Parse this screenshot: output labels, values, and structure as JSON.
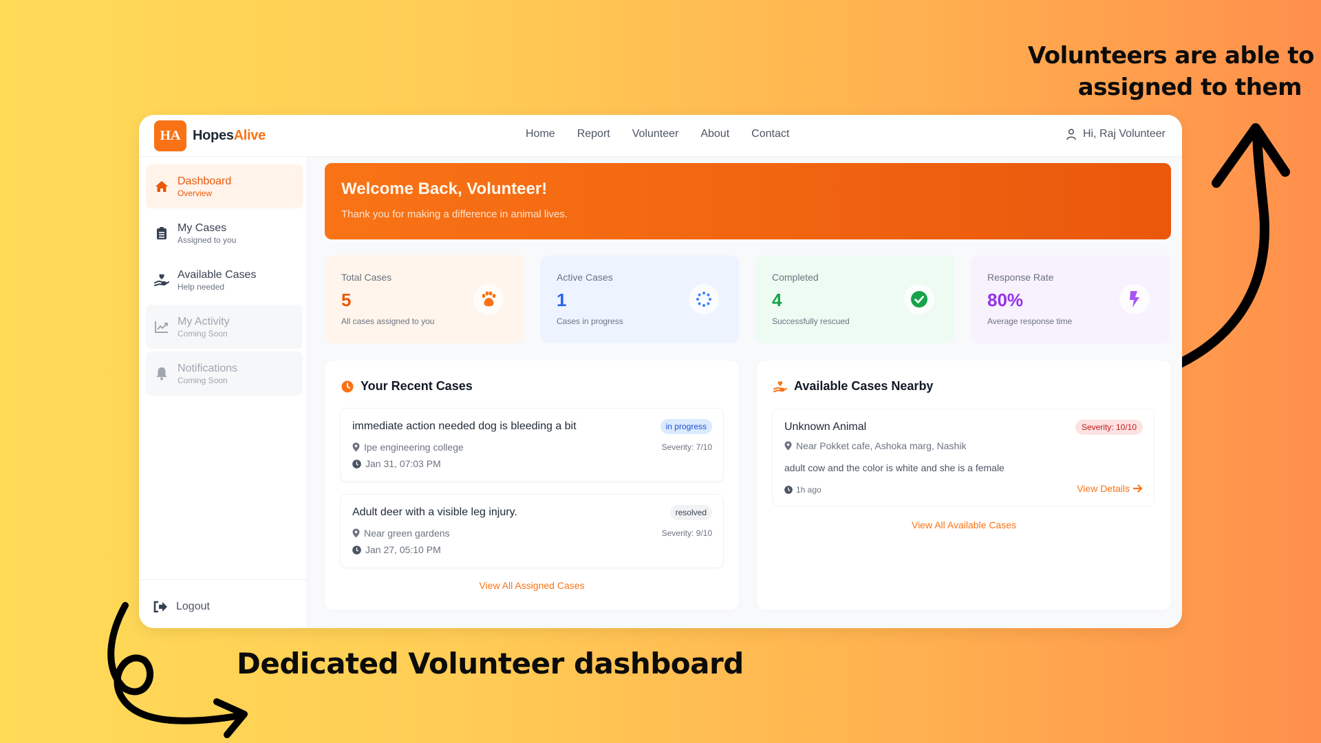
{
  "annotations": {
    "top_right_line1": "Volunteers are able to",
    "top_right_line2": "assigned to them",
    "bottom_caption": "Dedicated Volunteer dashboard"
  },
  "app": {
    "logo_badge": "HA",
    "logo_name_part1": "Hopes",
    "logo_name_part2": "Alive",
    "nav": [
      "Home",
      "Report",
      "Volunteer",
      "About",
      "Contact"
    ],
    "user_greeting": "Hi, Raj Volunteer"
  },
  "sidebar": {
    "items": [
      {
        "label": "Dashboard",
        "sub": "Overview",
        "icon": "home-icon",
        "state": "active"
      },
      {
        "label": "My Cases",
        "sub": "Assigned to you",
        "icon": "clipboard-icon",
        "state": "normal"
      },
      {
        "label": "Available Cases",
        "sub": "Help needed",
        "icon": "hand-heart-icon",
        "state": "normal"
      },
      {
        "label": "My Activity",
        "sub": "Coming Soon",
        "icon": "chart-line-icon",
        "state": "disabled"
      },
      {
        "label": "Notifications",
        "sub": "Coming Soon",
        "icon": "bell-icon",
        "state": "disabled"
      }
    ],
    "logout_label": "Logout"
  },
  "welcome": {
    "title": "Welcome Back, Volunteer!",
    "subtitle": "Thank you for making a difference in animal lives."
  },
  "stats": [
    {
      "label": "Total Cases",
      "value": "5",
      "sub": "All cases assigned to you",
      "icon": "paw-icon",
      "color": "#ea580c",
      "bg": "#fff5ec"
    },
    {
      "label": "Active Cases",
      "value": "1",
      "sub": "Cases in progress",
      "icon": "spinner-icon",
      "color": "#2563eb",
      "bg": "#eef4ff"
    },
    {
      "label": "Completed",
      "value": "4",
      "sub": "Successfully rescued",
      "icon": "check-circle-icon",
      "color": "#16a34a",
      "bg": "#eefbf3"
    },
    {
      "label": "Response Rate",
      "value": "80%",
      "sub": "Average response time",
      "icon": "bolt-icon",
      "color": "#9333ea",
      "bg": "#f8f1fe"
    }
  ],
  "recent_cases": {
    "title": "Your Recent Cases",
    "items": [
      {
        "title": "immediate action needed dog is bleeding a bit",
        "location": "Ipe engineering college",
        "time": "Jan 31, 07:03 PM",
        "status": "in progress",
        "severity": "Severity: 7/10"
      },
      {
        "title": "Adult deer with a visible leg injury.",
        "location": "Near green gardens",
        "time": "Jan 27, 05:10 PM",
        "status": "resolved",
        "severity": "Severity: 9/10"
      }
    ],
    "view_all": "View All Assigned Cases"
  },
  "available_cases": {
    "title": "Available Cases Nearby",
    "items": [
      {
        "title": "Unknown Animal",
        "severity": "Severity: 10/10",
        "location": "Near Pokket cafe, Ashoka marg, Nashik",
        "description": "adult cow and the color is white and she is a female",
        "time": "1h ago",
        "details_label": "View Details"
      }
    ],
    "view_all": "View All Available Cases"
  },
  "colors": {
    "brand": "#f97316",
    "brand_dark": "#ea580c",
    "in_progress_bg": "#dbeafe",
    "in_progress_fg": "#1d4ed8",
    "resolved_bg": "#f1f2f4",
    "resolved_fg": "#374151"
  }
}
